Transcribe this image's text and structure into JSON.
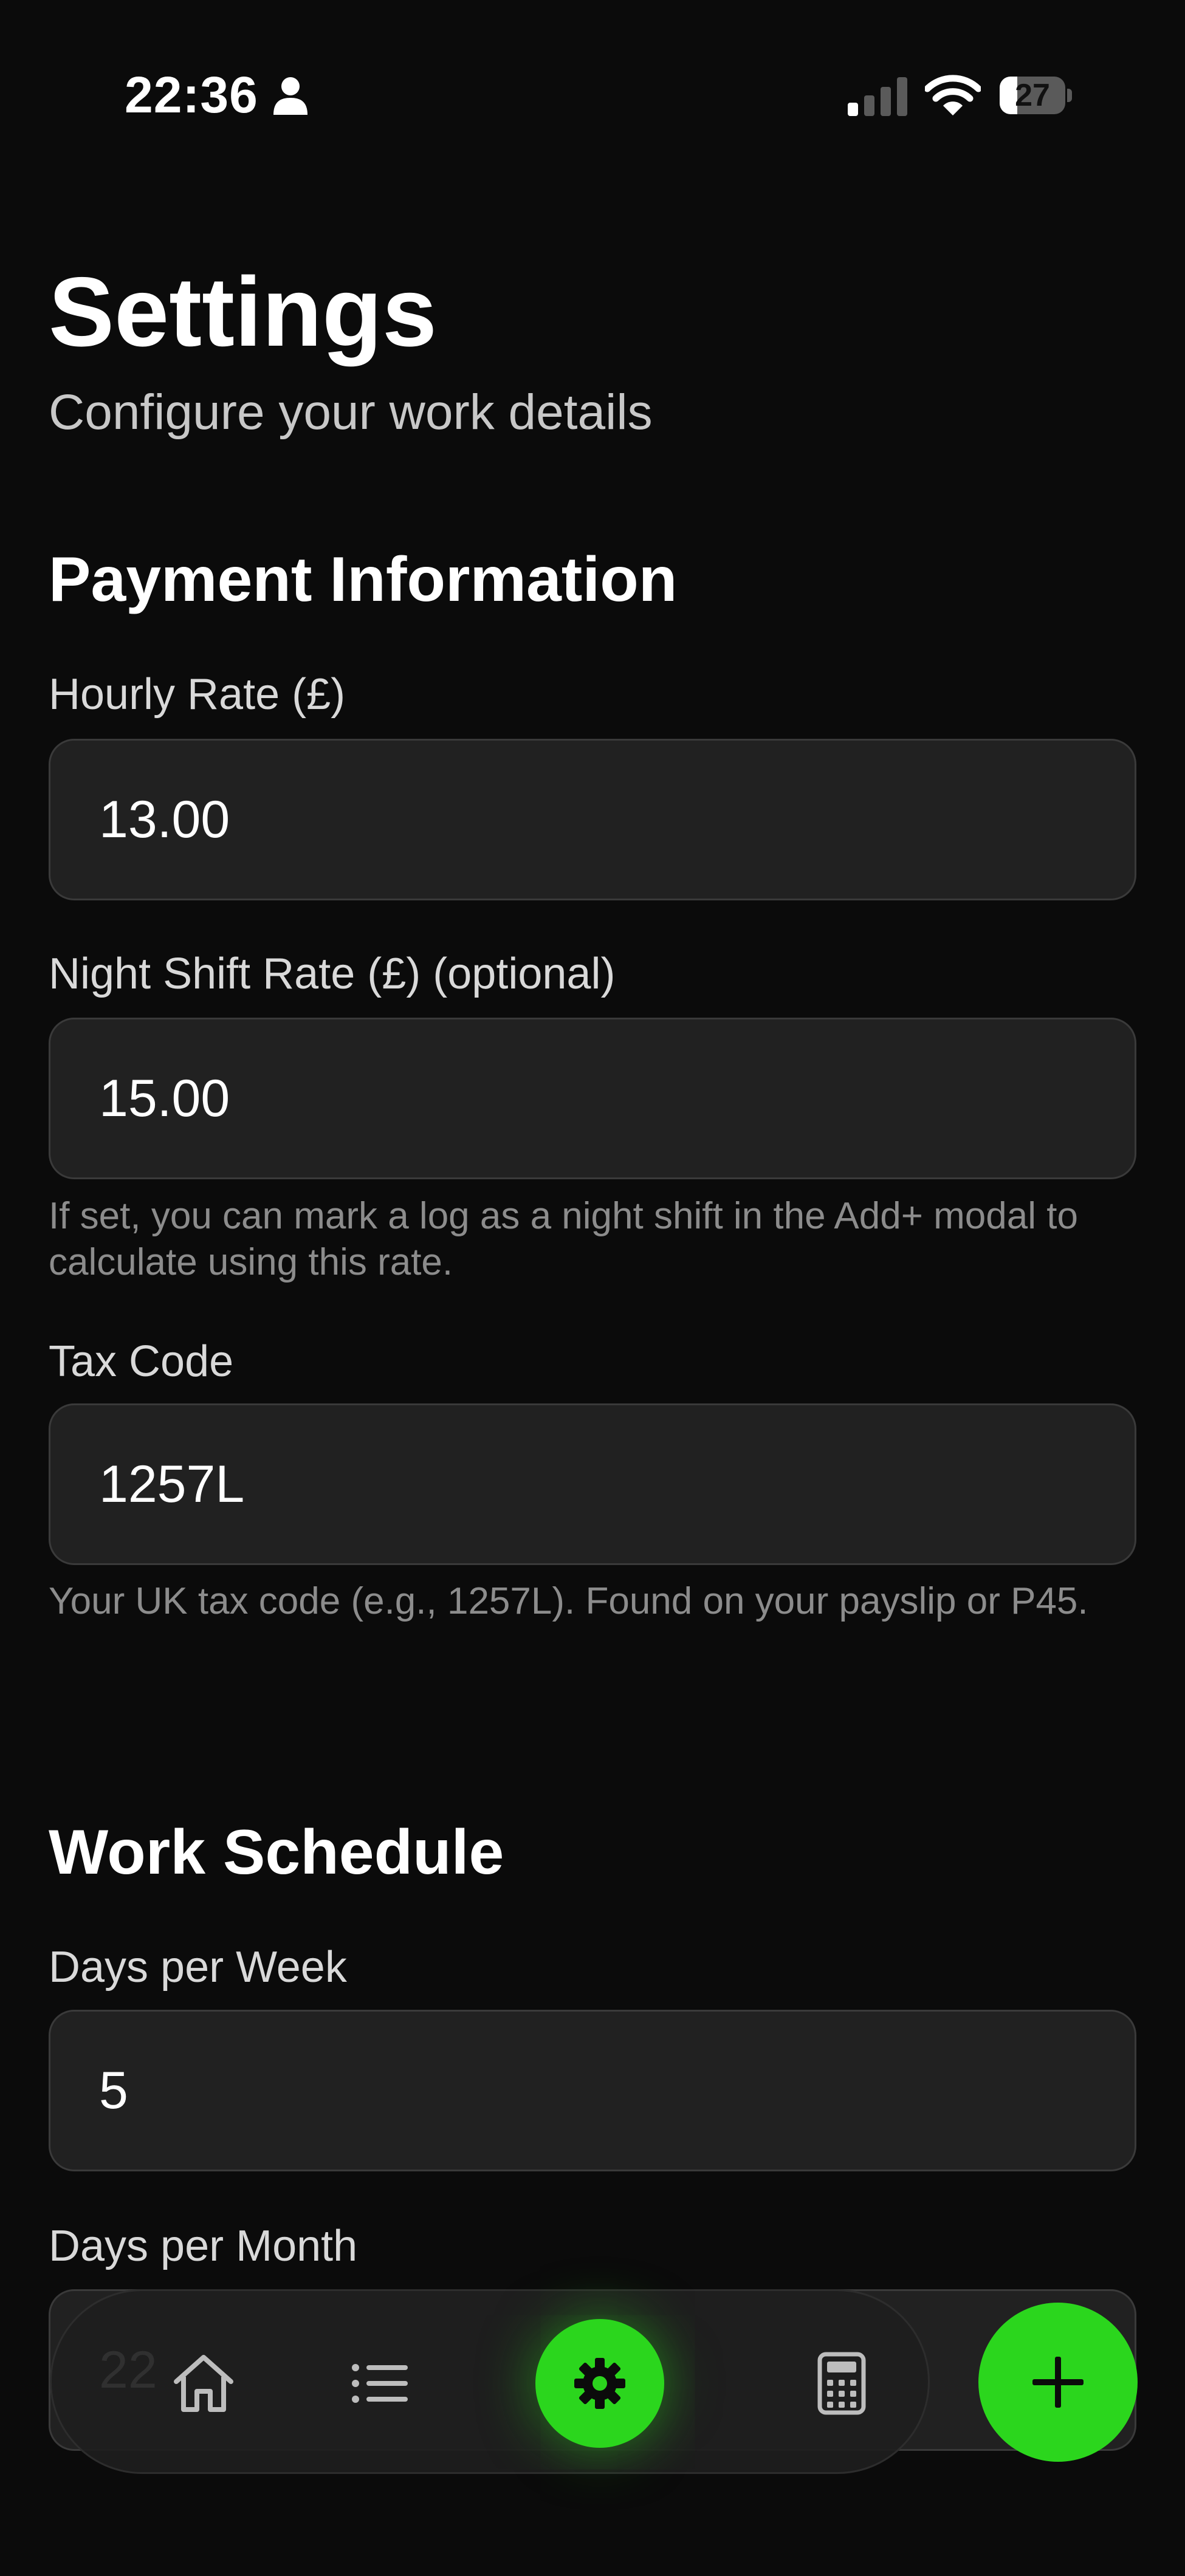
{
  "status_bar": {
    "time": "22:36",
    "battery": "27",
    "battery_level": 0.27,
    "icons": [
      "person-icon",
      "signal-icon",
      "wifi-icon",
      "battery-icon"
    ]
  },
  "header": {
    "title": "Settings",
    "subtitle": "Configure your work details"
  },
  "payment": {
    "section_title": "Payment Information",
    "hourly_rate": {
      "label": "Hourly Rate (£)",
      "value": "13.00"
    },
    "night_rate": {
      "label": "Night Shift Rate (£) (optional)",
      "value": "15.00",
      "help": "If set, you can mark a log as a night shift in the Add+ modal to calculate using this rate."
    },
    "tax_code": {
      "label": "Tax Code",
      "value": "1257L",
      "help": "Your UK tax code (e.g., 1257L). Found on your payslip or P45."
    }
  },
  "schedule": {
    "section_title": "Work Schedule",
    "days_per_week": {
      "label": "Days per Week",
      "value": "5"
    },
    "days_per_month": {
      "label": "Days per Month",
      "value": "22"
    }
  },
  "nav": {
    "items": [
      "home-icon",
      "list-icon",
      "gear-icon",
      "calculator-icon"
    ],
    "active": "gear-icon",
    "fab_icon": "plus-icon"
  },
  "colors": {
    "background": "#0b0b0b",
    "accent": "#2bd61d",
    "input_bg": "#212121"
  }
}
